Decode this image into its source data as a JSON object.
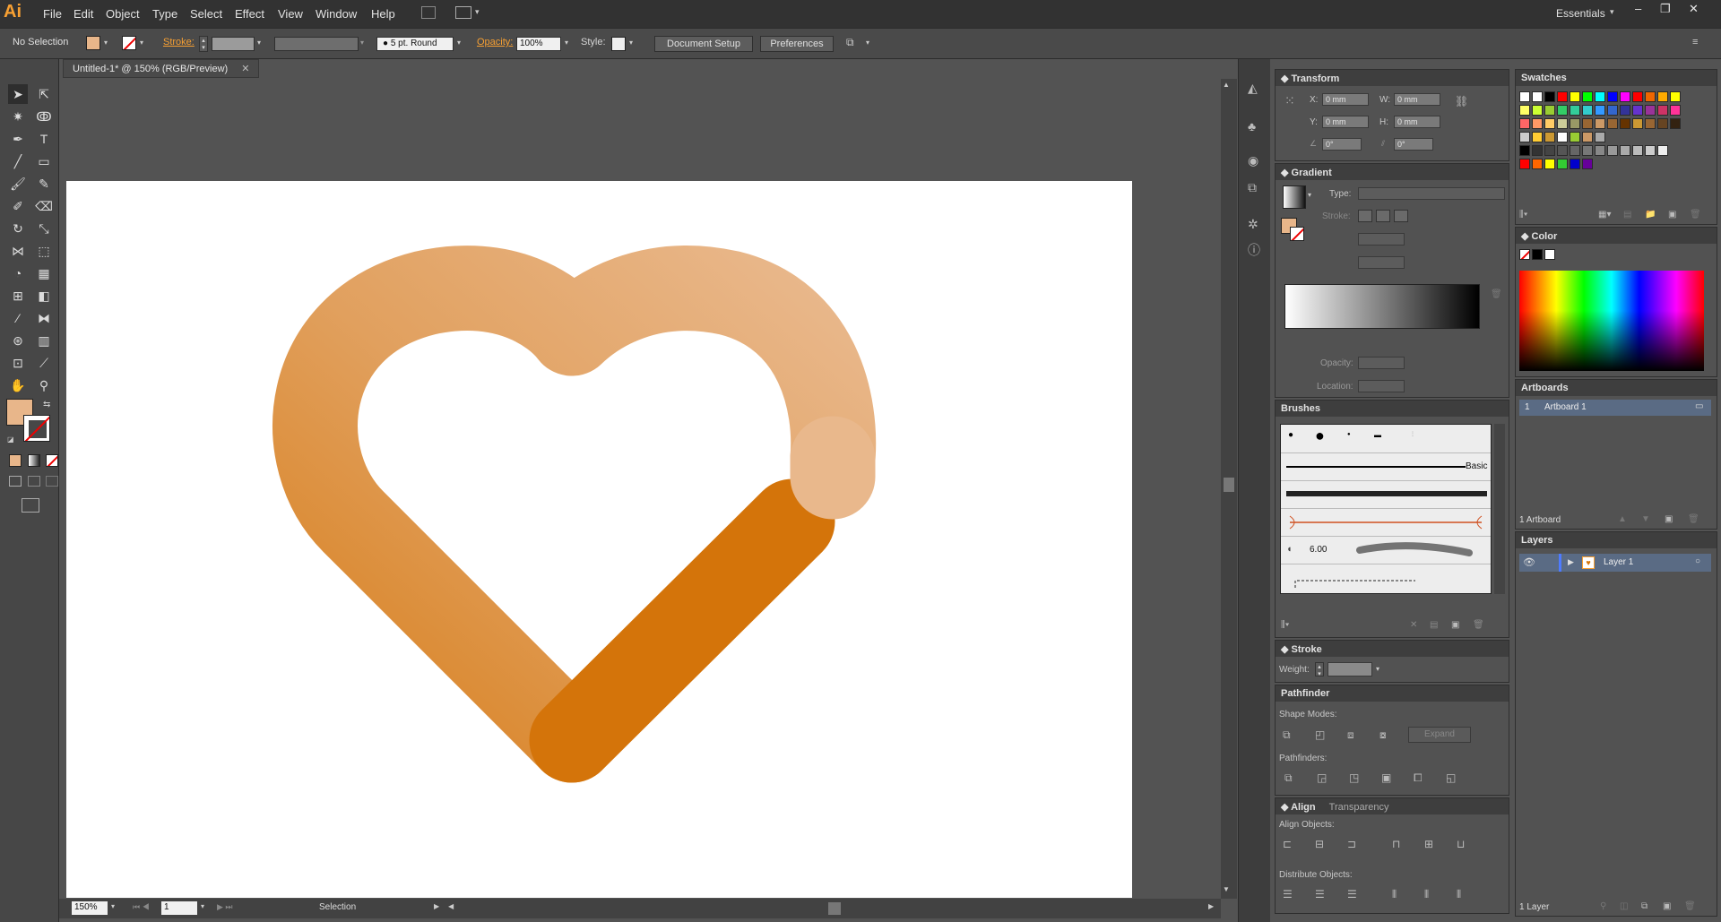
{
  "app": {
    "logo": "Ai",
    "workspace": "Essentials"
  },
  "menu": [
    "File",
    "Edit",
    "Object",
    "Type",
    "Select",
    "Effect",
    "View",
    "Window",
    "Help"
  ],
  "control_bar": {
    "selection_label": "No Selection",
    "stroke_label": "Stroke:",
    "brush_label": "5 pt. Round",
    "opacity_label": "Opacity:",
    "opacity_value": "100%",
    "style_label": "Style:",
    "document_setup": "Document Setup",
    "preferences": "Preferences"
  },
  "document": {
    "tab_title": "Untitled-1* @ 150% (RGB/Preview)"
  },
  "status_bar": {
    "zoom": "150%",
    "artboard_num": "1",
    "tool": "Selection"
  },
  "transform": {
    "title": "Transform",
    "x_label": "X:",
    "x": "0 mm",
    "y_label": "Y:",
    "y": "0 mm",
    "w_label": "W:",
    "w": "0 mm",
    "h_label": "H:",
    "h": "0 mm",
    "rot": "0°",
    "shear": "0°"
  },
  "gradient": {
    "title": "Gradient",
    "type_label": "Type:",
    "stroke_label": "Stroke:",
    "opacity_label": "Opacity:",
    "location_label": "Location:"
  },
  "brushes": {
    "title": "Brushes",
    "basic": "Basic",
    "size": "6.00"
  },
  "stroke": {
    "title": "Stroke",
    "weight_label": "Weight:"
  },
  "pathfinder": {
    "title": "Pathfinder",
    "shape_modes": "Shape Modes:",
    "expand": "Expand",
    "pathfinders": "Pathfinders:"
  },
  "align": {
    "title": "Align",
    "tab2": "Transparency",
    "align_objects": "Align Objects:",
    "distribute_objects": "Distribute Objects:"
  },
  "swatches": {
    "title": "Swatches"
  },
  "color": {
    "title": "Color"
  },
  "artboards": {
    "title": "Artboards",
    "rows": [
      {
        "num": "1",
        "name": "Artboard 1"
      }
    ],
    "count": "1 Artboard"
  },
  "layers": {
    "title": "Layers",
    "rows": [
      {
        "name": "Layer 1"
      }
    ],
    "count": "1 Layer"
  },
  "colors": {
    "fill": "#e8b68a",
    "heart_dark": "#d4740a",
    "heart_mid": "#e09a4f",
    "heart_light": "#e8b68a",
    "accent": "#f7a033"
  }
}
